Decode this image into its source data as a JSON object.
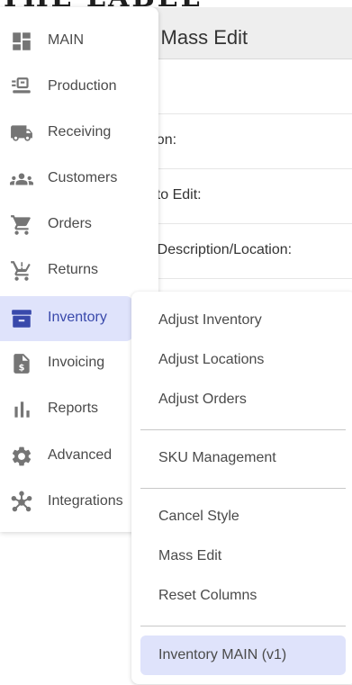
{
  "page": {
    "top_title": "THE LABEL",
    "title": "y - Mass Edit",
    "form_labels": [
      "eason:",
      "eld to Edit:",
      "KU/Description/Location:"
    ]
  },
  "sidebar": {
    "items": [
      {
        "label": "MAIN",
        "icon": "dashboard-icon"
      },
      {
        "label": "Production",
        "icon": "production-icon"
      },
      {
        "label": "Receiving",
        "icon": "truck-icon"
      },
      {
        "label": "Customers",
        "icon": "people-icon"
      },
      {
        "label": "Orders",
        "icon": "cart-icon"
      },
      {
        "label": "Returns",
        "icon": "return-cart-icon"
      },
      {
        "label": "Inventory",
        "icon": "archive-box-icon",
        "active": true
      },
      {
        "label": "Invoicing",
        "icon": "invoice-icon"
      },
      {
        "label": "Reports",
        "icon": "bar-chart-icon"
      },
      {
        "label": "Advanced",
        "icon": "gear-icon"
      },
      {
        "label": "Integrations",
        "icon": "hub-icon"
      }
    ]
  },
  "submenu": {
    "group1": [
      "Adjust Inventory",
      "Adjust Locations",
      "Adjust Orders"
    ],
    "group2": [
      "SKU Management"
    ],
    "group3": [
      "Cancel Style",
      "Mass Edit",
      "Reset Columns"
    ],
    "group4": [
      "Inventory MAIN (v1)"
    ]
  },
  "colors": {
    "active_bg": "#dfe3fb",
    "active_text": "#3949ab",
    "icon_gray": "#757575",
    "header_bg": "#eeeeee"
  }
}
